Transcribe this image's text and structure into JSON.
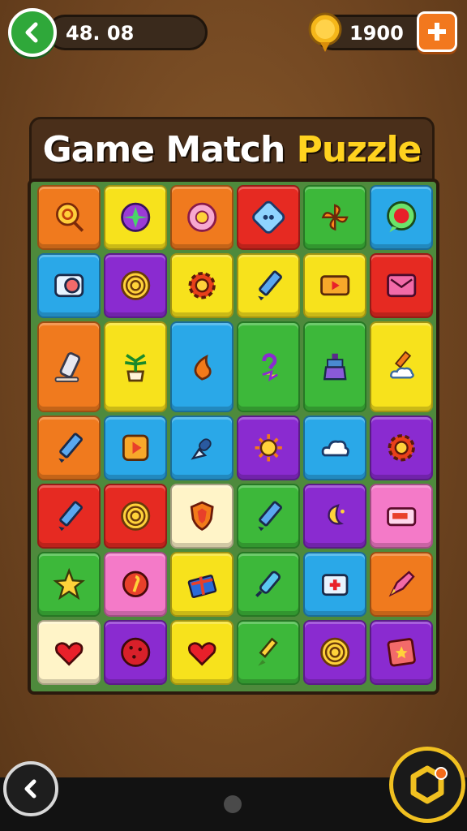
{
  "hud": {
    "timer": "48. 08",
    "coins": "1900"
  },
  "title": {
    "part1": "Game Match ",
    "part2": "Puzzle"
  },
  "colors": {
    "orange": "#f07a1e",
    "yellow": "#f7e21c",
    "red": "#e62a22",
    "green": "#3db83a",
    "blue": "#2aa8e8",
    "purple": "#8a2bd0",
    "pink": "#f47ac8",
    "cream": "#fff4c8"
  },
  "board": {
    "rows": [
      [
        "lollipop-icon",
        "star-gem-icon",
        "flower-icon",
        "dice-icon",
        "pinwheel-icon",
        "chat-ball-icon"
      ],
      [
        "camera-icon",
        "target-icon",
        "gear-icon",
        "pencil-icon",
        "video-icon",
        "mail-frame-icon"
      ],
      [
        "eraser-icon",
        "plant-icon",
        "flame-icon",
        "question-icon",
        "lantern-icon",
        "pencil-cloud-icon"
      ],
      [
        "pencil-icon",
        "play-icon",
        "pacifier-icon",
        "sun-icon",
        "cloud-icon",
        "gear-icon"
      ],
      [
        "pencil-icon",
        "target-icon",
        "shield-icon",
        "pencil-icon",
        "moon-icon",
        "card-icon"
      ],
      [
        "star-icon",
        "pin-icon",
        "gift-icon",
        "syringe-icon",
        "medkit-icon",
        "rocket-icon"
      ],
      [
        "heart-icon",
        "cookie-icon",
        "heart-icon",
        "brush-icon",
        "target-icon",
        "star-flag-icon"
      ]
    ],
    "tile_colors": [
      [
        "orange",
        "yellow",
        "orange",
        "red",
        "green",
        "blue"
      ],
      [
        "blue",
        "purple",
        "yellow",
        "yellow",
        "yellow",
        "red"
      ],
      [
        "orange",
        "yellow",
        "blue",
        "green",
        "green",
        "yellow"
      ],
      [
        "orange",
        "blue",
        "blue",
        "purple",
        "blue",
        "purple"
      ],
      [
        "red",
        "red",
        "cream",
        "green",
        "purple",
        "pink"
      ],
      [
        "green",
        "pink",
        "yellow",
        "green",
        "blue",
        "orange"
      ],
      [
        "cream",
        "purple",
        "yellow",
        "green",
        "purple",
        "purple"
      ]
    ]
  }
}
